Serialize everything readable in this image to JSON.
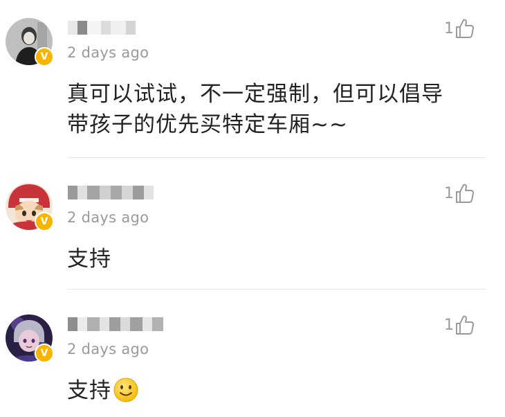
{
  "comments": [
    {
      "timestamp": "2 days ago",
      "likes": "1",
      "text_line1": "真可以试试，不一定强制，但可以倡导",
      "text_line2": "带孩子的优先买特定车厢~~",
      "badge": "V"
    },
    {
      "timestamp": "2 days ago",
      "likes": "1",
      "text": "支持",
      "badge": "V"
    },
    {
      "timestamp": "2 days ago",
      "likes": "1",
      "text": "支持",
      "emoji": "smile-emoji",
      "badge": "V"
    }
  ],
  "colors": {
    "badge": "#f7b500",
    "meta": "#9a9a9a",
    "text": "#222222",
    "divider": "#e4e4e4"
  }
}
